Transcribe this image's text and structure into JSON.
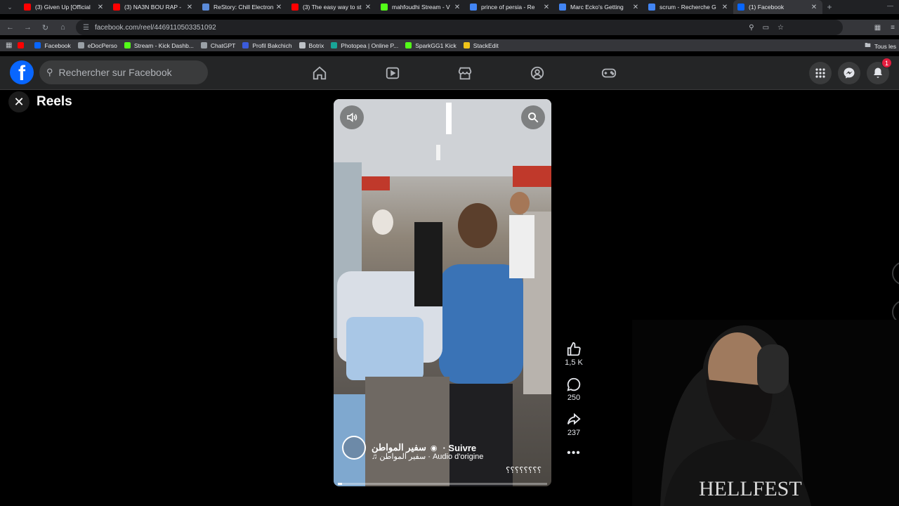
{
  "browser": {
    "tabs": [
      {
        "title": "(3) Given Up [Official",
        "favicon_color": "#ff0000"
      },
      {
        "title": "(3) NA3N BOU RAP -",
        "favicon_color": "#ff0000"
      },
      {
        "title": "ReStory: Chill Electron",
        "favicon_color": "#5b8bd9"
      },
      {
        "title": "(3) The easy way to st",
        "favicon_color": "#ff0000"
      },
      {
        "title": "mahfoudhi Stream - V",
        "favicon_color": "#53fc18"
      },
      {
        "title": "prince of persia - Re",
        "favicon_color": "#4285f4"
      },
      {
        "title": "Marc Ecko's Getting",
        "favicon_color": "#4285f4"
      },
      {
        "title": "scrum - Recherche G",
        "favicon_color": "#4285f4"
      },
      {
        "title": "(1) Facebook",
        "favicon_color": "#0866ff",
        "active": true
      }
    ],
    "url": "facebook.com/reel/4469110503351092",
    "bookmarks": [
      {
        "label": "",
        "color": "#ff0000"
      },
      {
        "label": "Facebook",
        "color": "#0866ff"
      },
      {
        "label": "eDocPerso",
        "color": "#9aa0a6"
      },
      {
        "label": "Stream - Kick Dashb...",
        "color": "#53fc18"
      },
      {
        "label": "ChatGPT",
        "color": "#9aa0a6"
      },
      {
        "label": "Profil Bakchich",
        "color": "#3b5bdb"
      },
      {
        "label": "Botrix",
        "color": "#bdc1c6"
      },
      {
        "label": "Photopea | Online P...",
        "color": "#18a497"
      },
      {
        "label": "SparkGG1 Kick",
        "color": "#53fc18"
      },
      {
        "label": "StackEdit",
        "color": "#f0c419"
      }
    ],
    "bookmarks_all": "Tous les"
  },
  "facebook": {
    "search_placeholder": "Rechercher sur Facebook",
    "notification_count": "1",
    "reels_title": "Reels"
  },
  "reel": {
    "owner_name": "سفير المواطن",
    "follow_label": "Suivre",
    "audio_label": "سفير المواطن · Audio d'origine",
    "caption": "؟؟؟؟؟؟؟؟",
    "progress": 0.02,
    "likes": "1,5 K",
    "comments": "250",
    "shares": "237"
  }
}
